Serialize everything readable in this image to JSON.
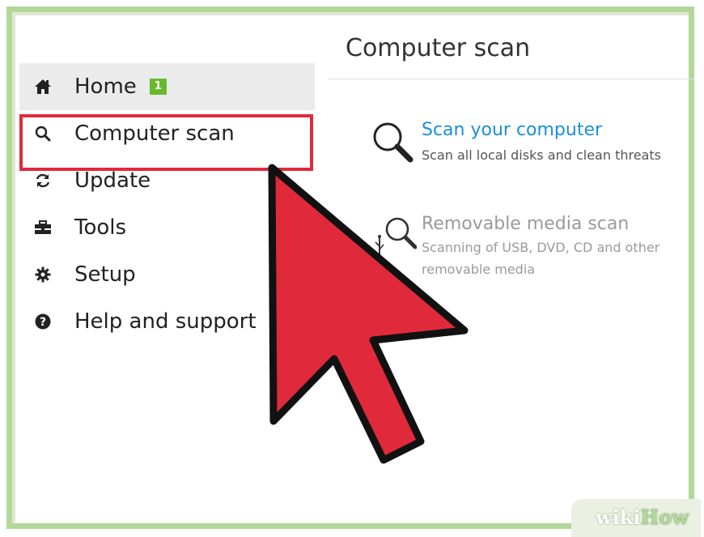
{
  "main": {
    "title": "Computer scan",
    "options": [
      {
        "title": "Scan your computer",
        "description": "Scan all local disks and clean threats",
        "icon": "magnifier-icon",
        "state": "enabled"
      },
      {
        "title": "Removable media scan",
        "description_lines": [
          "Scanning of USB, DVD, CD and other",
          "removable media"
        ],
        "icon": "usb-magnifier-icon",
        "state": "disabled"
      }
    ]
  },
  "sidebar": {
    "items": [
      {
        "label": "Home",
        "icon": "home-icon",
        "badge": "1",
        "selected": true
      },
      {
        "label": "Computer scan",
        "icon": "search-icon",
        "highlighted": true
      },
      {
        "label": "Update",
        "icon": "refresh-icon"
      },
      {
        "label": "Tools",
        "icon": "toolbox-icon"
      },
      {
        "label": "Setup",
        "icon": "gear-icon"
      },
      {
        "label": "Help and support",
        "icon": "help-icon"
      }
    ]
  },
  "watermark": {
    "part1": "wiki",
    "part2": "How"
  },
  "colors": {
    "frame": "#b3d89a",
    "badge": "#69b92e",
    "highlight_border": "#e02a3b",
    "cursor_fill": "#e02a3b",
    "link": "#1a8fd6",
    "disabled_text": "#9a9a9a"
  }
}
